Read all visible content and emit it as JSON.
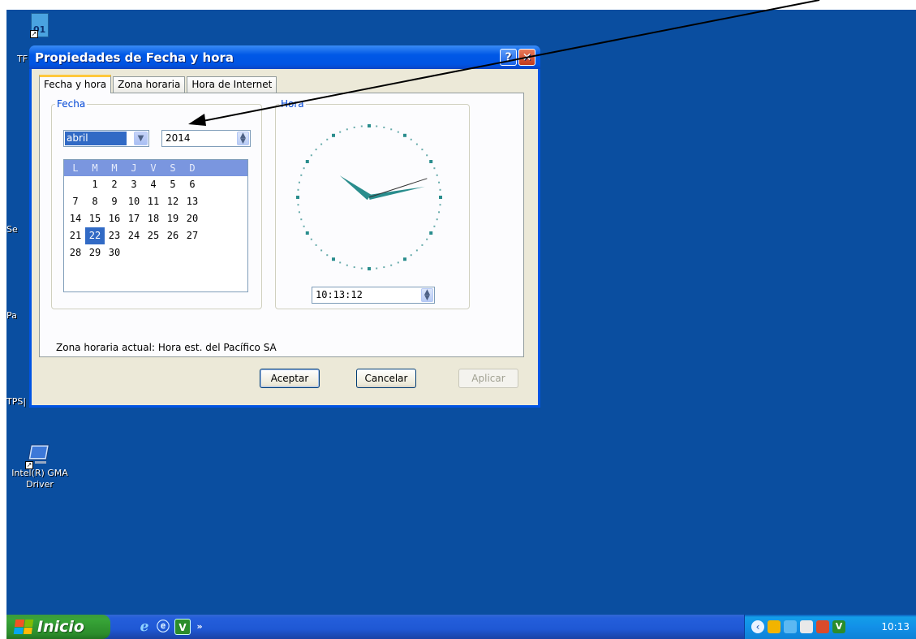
{
  "desktop": {
    "icons": [
      {
        "label": "01"
      },
      {
        "label": "Intel(R) GMA Driver"
      }
    ],
    "edge_labels": [
      "TF",
      "Se",
      "Pa",
      "TPS|"
    ]
  },
  "dialog": {
    "title": "Propiedades de Fecha y hora",
    "help_glyph": "?",
    "close_glyph": "✕",
    "tabs": [
      {
        "label": "Fecha y hora",
        "active": true
      },
      {
        "label": "Zona horaria",
        "active": false
      },
      {
        "label": "Hora de Internet",
        "active": false
      }
    ],
    "date_group": {
      "legend": "Fecha",
      "month": "abril",
      "year": "2014",
      "weekday_headers": [
        "L",
        "M",
        "M",
        "J",
        "V",
        "S",
        "D"
      ],
      "weeks": [
        [
          "",
          "1",
          "2",
          "3",
          "4",
          "5",
          "6"
        ],
        [
          "7",
          "8",
          "9",
          "10",
          "11",
          "12",
          "13"
        ],
        [
          "14",
          "15",
          "16",
          "17",
          "18",
          "19",
          "20"
        ],
        [
          "21",
          "22",
          "23",
          "24",
          "25",
          "26",
          "27"
        ],
        [
          "28",
          "29",
          "30",
          "",
          "",
          "",
          ""
        ]
      ],
      "selected_day": "22"
    },
    "time_group": {
      "legend": "Hora",
      "time": "10:13:12"
    },
    "current_timezone": "Zona horaria actual:  Hora est. del Pacífico SA",
    "buttons": {
      "ok": "Aceptar",
      "cancel": "Cancelar",
      "apply": "Aplicar"
    }
  },
  "taskbar": {
    "start_label": "Inicio",
    "clock": "10:13",
    "chevron": "»"
  },
  "colors": {
    "desktop": "#0a4ea0",
    "title_bar": "#0054e3",
    "selection": "#316ac5",
    "hand": "#2a8d8d"
  }
}
